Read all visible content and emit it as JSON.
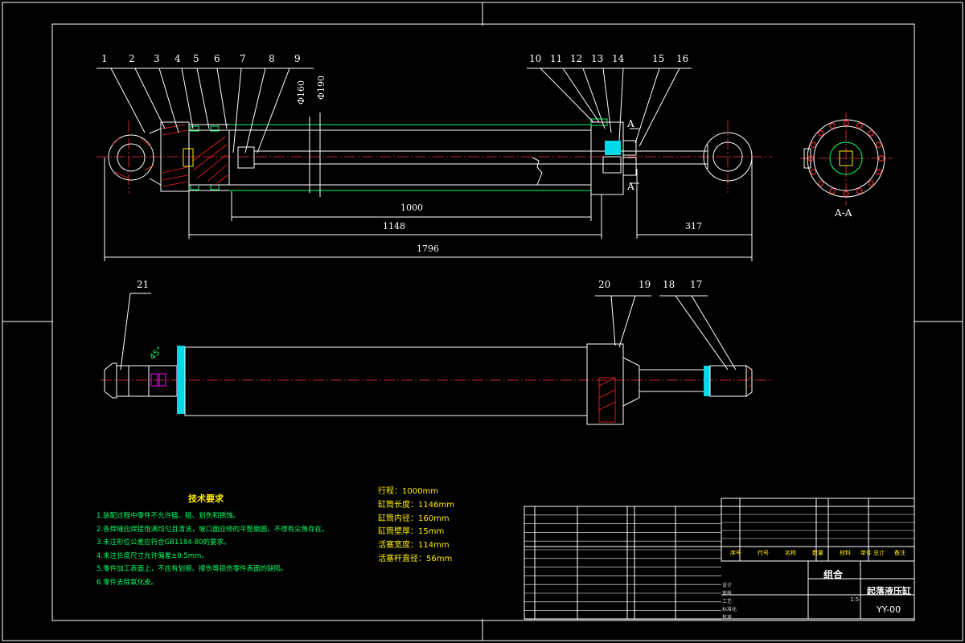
{
  "balloons_top": [
    "1",
    "2",
    "3",
    "4",
    "5",
    "6",
    "7",
    "8",
    "9",
    "10",
    "11",
    "12",
    "13",
    "14",
    "15",
    "16"
  ],
  "balloons_bottom": [
    "21",
    "20",
    "19",
    "18",
    "17"
  ],
  "dims": {
    "d1": "1000",
    "d2": "1148",
    "d3": "1796",
    "d4": "317",
    "dia_bore": "Φ160",
    "dia_outer": "Φ190",
    "section_mark": "A",
    "section_label": "A-A",
    "angle_note": "45°"
  },
  "tech_req": {
    "title": "技术要求",
    "items": [
      "1.装配过程中零件不允许磕、碰、划伤和锈蚀。",
      "2.各焊缝应焊接饱满均匀且清洁，坡口面应修的平整磨圆，不得有尖角存在。",
      "3.未注形位公差应符合GB1184-80的要求。",
      "4.未注长度尺寸允许偏差±0.5mm。",
      "5.零件加工表面上，不应有划痕、擦伤等损伤零件表面的缺陷。",
      "6.零件去除氧化皮。"
    ]
  },
  "specs": [
    "行程：1000mm",
    "缸筒长度：1146mm",
    "缸筒内径：160mm",
    "缸筒壁厚：15mm",
    "活塞宽度：114mm",
    "活塞杆直径：56mm"
  ],
  "title_block": {
    "assembly": "组合",
    "drawing_name": "起落液压缸",
    "drawing_no": "YY-00",
    "header_cols": [
      "序号",
      "代号",
      "名称",
      "数量",
      "材料",
      "单件 总计",
      "备注"
    ],
    "row_labels": [
      "设计",
      "审核",
      "工艺",
      "标准化",
      "批准"
    ],
    "scale": "1:5"
  }
}
